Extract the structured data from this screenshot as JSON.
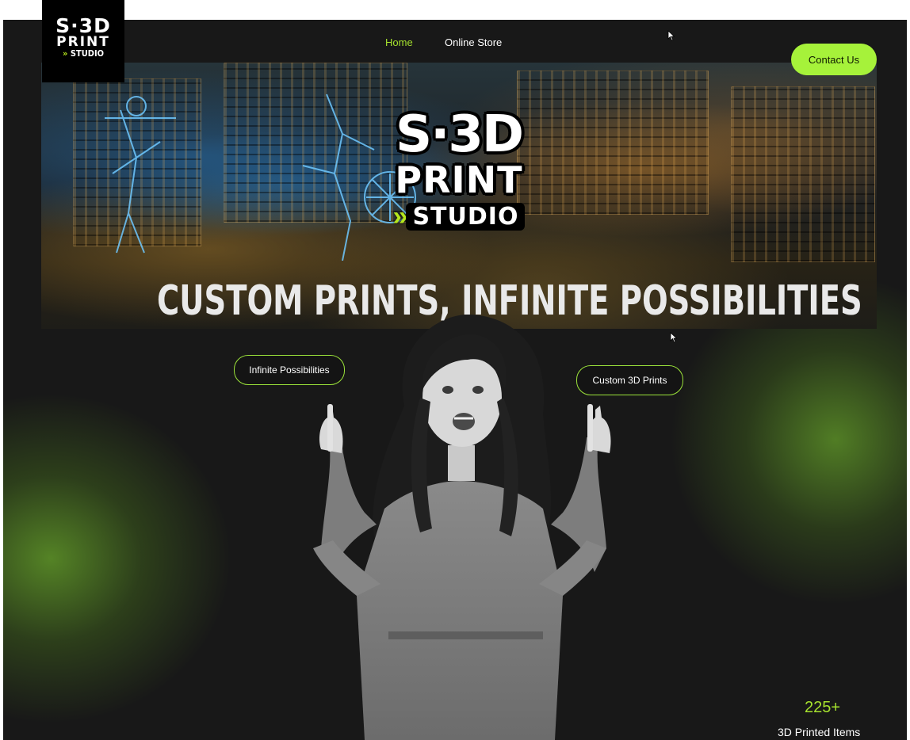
{
  "header": {
    "logo": {
      "line1": "S·3D",
      "line2": "PRINT",
      "line3": "STUDIO"
    },
    "nav": [
      {
        "label": "Home",
        "active": true
      },
      {
        "label": "Online Store",
        "active": false
      }
    ],
    "contact_label": "Contact Us"
  },
  "hero": {
    "logo": {
      "line1": "S·3D",
      "line2": "PRINT",
      "line3": "STUDIO"
    },
    "headline": "CUSTOM PRINTS, INFINITE POSSIBILITIES",
    "pill_left": "Infinite Possibilities",
    "pill_right": "Custom 3D Prints"
  },
  "stats": {
    "value": "225+",
    "label": "3D Printed Items"
  },
  "colors": {
    "accent": "#a6f23a",
    "background": "#181818",
    "glow": "#5f9628"
  },
  "icons": [
    "cursor-icon",
    "chevron-icon"
  ]
}
